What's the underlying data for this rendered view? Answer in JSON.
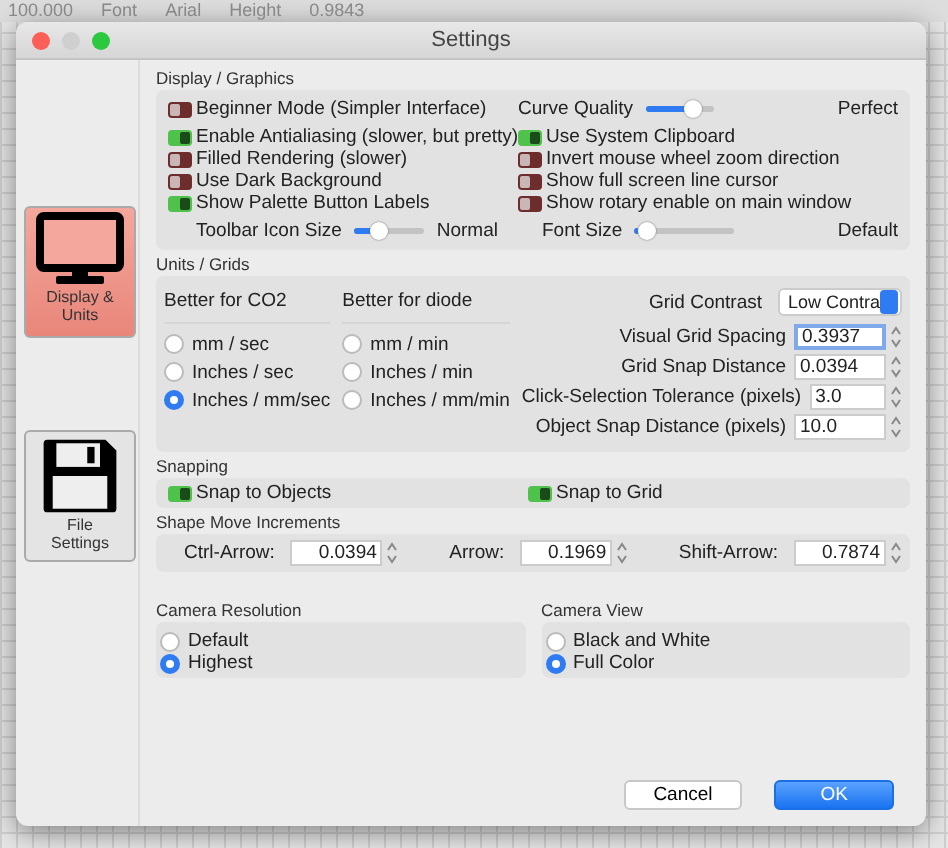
{
  "background": {
    "toolbar": [
      "100.000",
      "Font",
      "Arial",
      "Height",
      "0.9843"
    ]
  },
  "window": {
    "title": "Settings"
  },
  "sidebar": [
    {
      "label": "Display & Units",
      "kind": "monitor",
      "selected": true
    },
    {
      "label": "File Settings",
      "kind": "disk",
      "selected": false
    }
  ],
  "display": {
    "title": "Display / Graphics",
    "beginner": {
      "label": "Beginner Mode (Simpler Interface)",
      "on": false
    },
    "curve_quality": {
      "label": "Curve Quality",
      "level": 0.78,
      "value": "Perfect"
    },
    "toggles_left": [
      {
        "label": "Enable Antialiasing (slower, but pretty)",
        "on": true
      },
      {
        "label": "Filled Rendering (slower)",
        "on": false
      },
      {
        "label": "Use Dark Background",
        "on": false
      },
      {
        "label": "Show Palette Button Labels",
        "on": true
      }
    ],
    "toggles_right": [
      {
        "label": "Use System Clipboard",
        "on": true
      },
      {
        "label": "Invert mouse wheel zoom direction",
        "on": false
      },
      {
        "label": "Show full screen line cursor",
        "on": false
      },
      {
        "label": "Show rotary enable on main window",
        "on": false
      }
    ],
    "toolbar_icon_size": {
      "label": "Toolbar Icon Size",
      "level": 0.3,
      "value": "Normal"
    },
    "font_size": {
      "label": "Font Size",
      "level": 0.05,
      "value": "Default"
    }
  },
  "units": {
    "title": "Units / Grids",
    "groups": [
      {
        "title": "Better for CO2",
        "options": [
          {
            "label": "mm / sec",
            "selected": false
          },
          {
            "label": "Inches / sec",
            "selected": false
          },
          {
            "label": "Inches / mm/sec",
            "selected": true
          }
        ]
      },
      {
        "title": "Better for diode",
        "options": [
          {
            "label": "mm / min",
            "selected": false
          },
          {
            "label": "Inches / min",
            "selected": false
          },
          {
            "label": "Inches / mm/min",
            "selected": false
          }
        ]
      }
    ],
    "grid_contrast": {
      "label": "Grid Contrast",
      "value": "Low Contra"
    },
    "fields": [
      {
        "label": "Visual Grid Spacing",
        "value": "0.3937",
        "focused": true
      },
      {
        "label": "Grid Snap Distance",
        "value": "0.0394",
        "focused": false
      },
      {
        "label": "Click-Selection Tolerance (pixels)",
        "value": "3.0",
        "focused": false
      },
      {
        "label": "Object Snap Distance (pixels)",
        "value": "10.0",
        "focused": false
      }
    ]
  },
  "snapping": {
    "title": "Snapping",
    "toggles": [
      {
        "label": "Snap to Objects",
        "on": true
      },
      {
        "label": "Snap to Grid",
        "on": true
      }
    ]
  },
  "increments": {
    "title": "Shape Move Increments",
    "fields": [
      {
        "label": "Ctrl-Arrow:",
        "value": "0.0394"
      },
      {
        "label": "Arrow:",
        "value": "0.1969"
      },
      {
        "label": "Shift-Arrow:",
        "value": "0.7874"
      }
    ]
  },
  "camera": [
    {
      "title": "Camera Resolution",
      "options": [
        {
          "label": "Default",
          "selected": false
        },
        {
          "label": "Highest",
          "selected": true
        }
      ]
    },
    {
      "title": "Camera View",
      "options": [
        {
          "label": "Black and White",
          "selected": false
        },
        {
          "label": "Full Color",
          "selected": true
        }
      ]
    }
  ],
  "buttons": [
    {
      "label": "Cancel",
      "kind": "secondary"
    },
    {
      "label": "OK",
      "kind": "primary"
    }
  ]
}
